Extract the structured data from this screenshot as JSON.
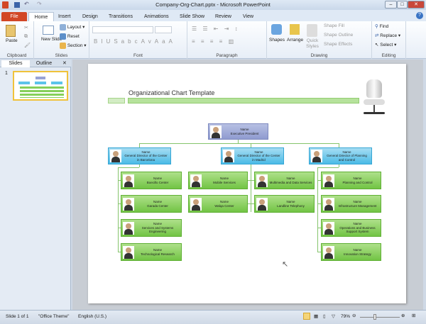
{
  "window": {
    "title": "Company-Org-Chart.pptx - Microsoft PowerPoint"
  },
  "tabs": [
    "File",
    "Home",
    "Insert",
    "Design",
    "Transitions",
    "Animations",
    "Slide Show",
    "Review",
    "View"
  ],
  "ribbon": {
    "clipboard": {
      "label": "Clipboard",
      "paste": "Paste"
    },
    "slides": {
      "label": "Slides",
      "new_slide": "New Slide",
      "layout": "Layout",
      "reset": "Reset",
      "section": "Section"
    },
    "font": {
      "label": "Font"
    },
    "paragraph": {
      "label": "Paragraph"
    },
    "drawing": {
      "label": "Drawing",
      "shapes": "Shapes",
      "arrange": "Arrange",
      "quick_styles": "Quick Styles",
      "shape_fill": "Shape Fill",
      "shape_outline": "Shape Outline",
      "shape_effects": "Shape Effects"
    },
    "editing": {
      "label": "Editing",
      "find": "Find",
      "replace": "Replace",
      "select": "Select"
    }
  },
  "panel": {
    "tabs": [
      "Slides",
      "Outline"
    ],
    "slide_number": "1"
  },
  "slide": {
    "title": "Organizational Chart Template",
    "exec": {
      "name": "Name",
      "role": "Executive President"
    },
    "directors": [
      {
        "name": "Name",
        "role": "General Director of the Center in Barcelona"
      },
      {
        "name": "Name",
        "role": "General Director of the Center in Madrid"
      },
      {
        "name": "Name",
        "role": "General Director of Planning and Control"
      }
    ],
    "col1": [
      {
        "name": "Name",
        "role": "Boecillo Center"
      },
      {
        "name": "Name",
        "role": "Garada Center"
      },
      {
        "name": "Name",
        "role": "Services and Systems Engineering"
      },
      {
        "name": "Name",
        "role": "Technological Research"
      }
    ],
    "col2": [
      {
        "name": "Name",
        "role": "Mobile Services"
      },
      {
        "name": "Name",
        "role": "Walqa Center"
      }
    ],
    "col3": [
      {
        "name": "Name",
        "role": "Multimedia and Data Services"
      },
      {
        "name": "Name",
        "role": "Landline Telephony"
      }
    ],
    "col4": [
      {
        "name": "Name",
        "role": "Planning and Control"
      },
      {
        "name": "Name",
        "role": "Infrastructure Management"
      },
      {
        "name": "Name",
        "role": "Operations and Business Support System"
      },
      {
        "name": "Name",
        "role": "Innovation Strategy"
      }
    ]
  },
  "status": {
    "slide": "Slide 1 of 1",
    "theme": "\"Office Theme\"",
    "language": "English (U.S.)",
    "zoom": "79%",
    "zoom_percent": 79
  }
}
